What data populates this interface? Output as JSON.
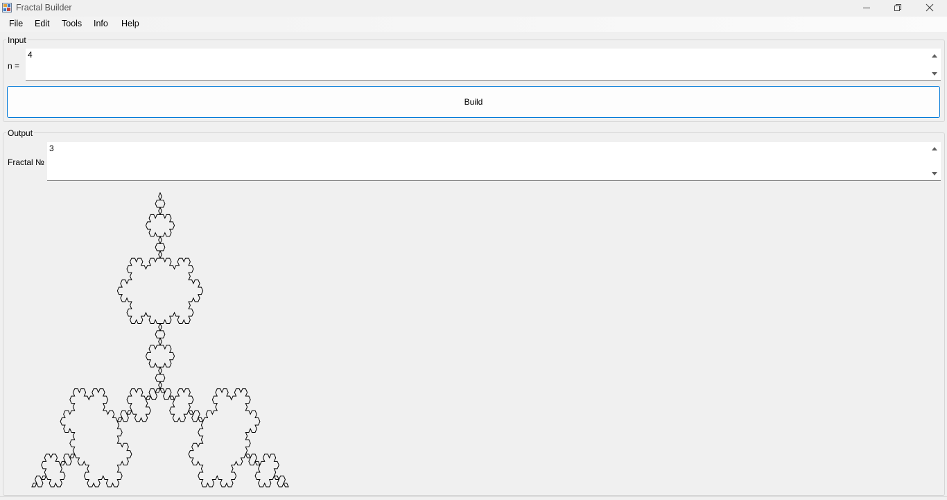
{
  "window": {
    "title": "Fractal Builder",
    "icon": "app-icon"
  },
  "menu": {
    "items": [
      "File",
      "Edit",
      "Tools",
      "Info",
      "Help"
    ]
  },
  "input_group": {
    "label": "Input",
    "n_label": "n =",
    "n_value": "4"
  },
  "build_button": {
    "label": "Build",
    "accent": "#0078d7"
  },
  "output_group": {
    "label": "Output",
    "fractal_label": "Fractal №",
    "fractal_value": "3"
  },
  "fractal": {
    "type": "koch-snowflake",
    "iterations": 4,
    "stroke_color": "#000000"
  }
}
